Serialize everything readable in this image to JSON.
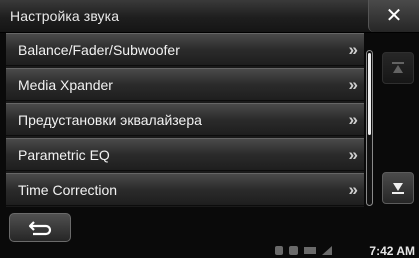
{
  "header": {
    "title": "Настройка звука",
    "close_icon": "close-icon"
  },
  "menu": {
    "items": [
      {
        "label": "Balance/Fader/Subwoofer",
        "icon": "double-chevron-right-icon"
      },
      {
        "label": "Media Xpander",
        "icon": "double-chevron-right-icon"
      },
      {
        "label": "Предустановки эквалайзера",
        "icon": "double-chevron-right-icon"
      },
      {
        "label": "Parametric EQ",
        "icon": "double-chevron-right-icon"
      },
      {
        "label": "Time Correction",
        "icon": "double-chevron-right-icon"
      }
    ],
    "chevron_glyph": "»"
  },
  "scroll": {
    "up_icon": "scroll-up-icon",
    "down_icon": "scroll-down-icon",
    "up_enabled": false
  },
  "footer": {
    "back_icon": "back-arrow-icon"
  },
  "status": {
    "time": "7:42 AM"
  },
  "colors": {
    "background": "#0a0a0a",
    "row_top": "#4a4a4a",
    "row_bottom": "#1e1e1e",
    "text": "#f2f2f2"
  }
}
